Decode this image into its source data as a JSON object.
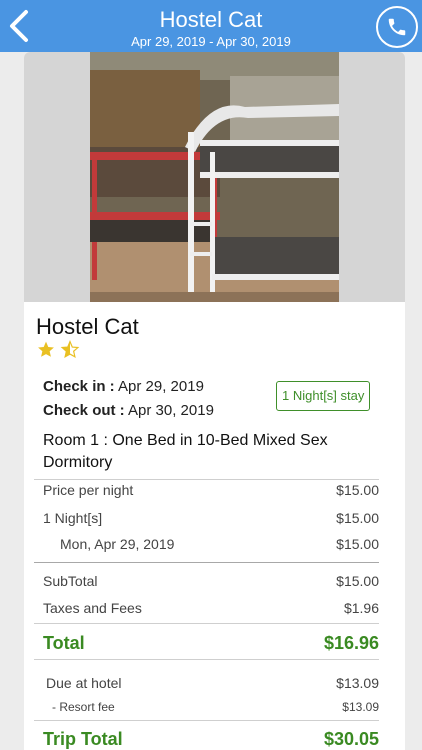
{
  "header": {
    "title": "Hostel Cat",
    "dates": "Apr 29, 2019 - Apr 30, 2019",
    "back_icon": "chevron-left-icon",
    "phone_icon": "phone-icon"
  },
  "hotel": {
    "name": "Hostel Cat",
    "rating": 1.5,
    "stars_display": "★⯪"
  },
  "stay": {
    "checkin_label": "Check in :",
    "checkin_value": " Apr 29, 2019",
    "checkout_label": "Check out :",
    "checkout_value": " Apr 30, 2019",
    "nights_badge": "1 Night[s] stay"
  },
  "room": {
    "title": "Room 1 : One Bed in 10-Bed Mixed Sex Dormitory"
  },
  "pricing": {
    "price_per_night_label": "Price per night",
    "price_per_night": "$15.00",
    "nights_label": "1 Night[s]",
    "nights_value": "$15.00",
    "date_label": "Mon, Apr 29, 2019",
    "date_value": "$15.00",
    "subtotal_label": "SubTotal",
    "subtotal": "$15.00",
    "taxes_label": "Taxes and Fees",
    "taxes": "$1.96",
    "total_label": "Total",
    "total": "$16.96",
    "due_label": "Due at hotel",
    "due": "$13.09",
    "resort_label": "- Resort fee",
    "resort": "$13.09",
    "trip_total_label": "Trip Total",
    "trip_total": "$30.05"
  },
  "colors": {
    "header": "#4a95e2",
    "green": "#3a8a22",
    "star": "#e9c023"
  }
}
